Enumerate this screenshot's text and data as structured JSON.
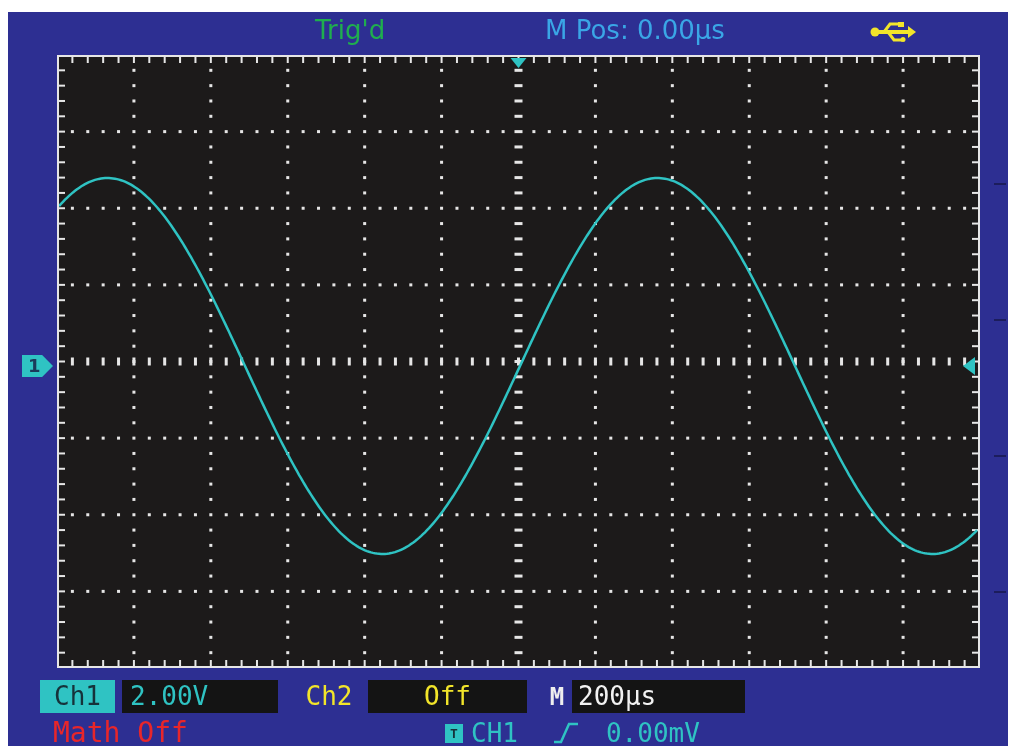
{
  "status_bar": {
    "trigger_status": "Trig'd",
    "main_position": "M Pos: 0.00µs"
  },
  "display": {
    "channel_marker": "1"
  },
  "channels": [
    {
      "label": "Ch1",
      "value": "2.00V",
      "selected": true,
      "color": "#2fc3c3"
    },
    {
      "label": "Ch2",
      "value": "Off",
      "selected": false,
      "color": "#f2e52a"
    }
  ],
  "timebase": {
    "label": "M",
    "value": "200µs"
  },
  "math": "Math Off",
  "trigger": {
    "badge": "T",
    "source": "CH1",
    "level": "0.00mV"
  }
}
